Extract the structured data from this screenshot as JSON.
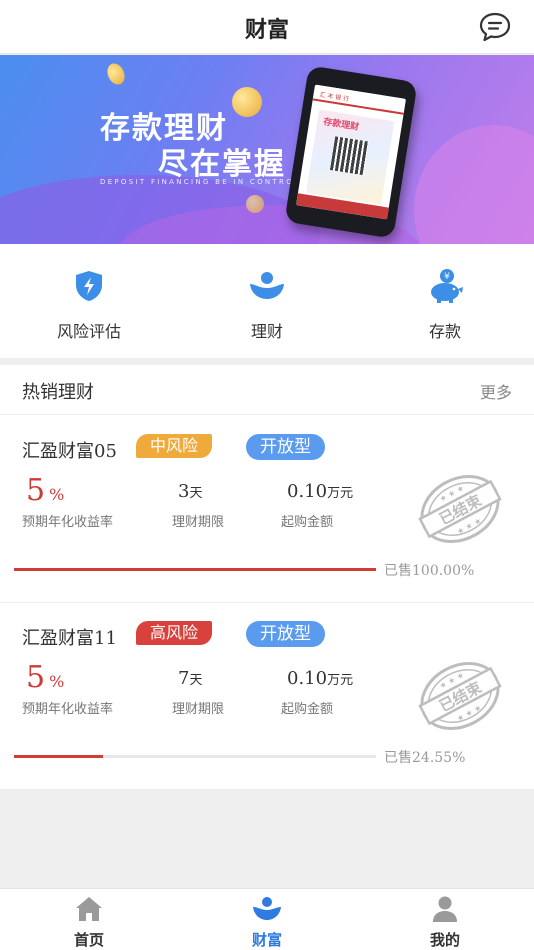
{
  "header": {
    "title": "财富",
    "message_icon": "chat-bubble-icon"
  },
  "banner": {
    "headline_1": "存款理财",
    "headline_2": "尽在掌握",
    "subtitle": "DEPOSIT FINANCING BE IN CONTROL",
    "phone_screen_title": "汇 丰 银 行",
    "phone_screen_text": "存款理财"
  },
  "quick_menu": [
    {
      "label": "风险评估",
      "icon": "shield-bolt-icon"
    },
    {
      "label": "理财",
      "icon": "wealth-icon"
    },
    {
      "label": "存款",
      "icon": "piggy-bank-icon"
    }
  ],
  "hot_products": {
    "title": "热销理财",
    "more": "更多",
    "captions": {
      "rate": "预期年化收益率",
      "term": "理财期限",
      "min_amount": "起购金额"
    },
    "items": [
      {
        "name": "汇盈财富05",
        "risk": "中风险",
        "risk_color": "#f0a93b",
        "type": "开放型",
        "rate": "5",
        "rate_unit": "%",
        "term": "3",
        "term_unit": "天",
        "min_amount": "0.10",
        "min_amount_unit": "万元",
        "stamp": "已结束",
        "sold_label": "已售100.00%",
        "sold_fraction": 1.0
      },
      {
        "name": "汇盈财富11",
        "risk": "高风险",
        "risk_color": "#d9423c",
        "type": "开放型",
        "rate": "5",
        "rate_unit": "%",
        "term": "7",
        "term_unit": "天",
        "min_amount": "0.10",
        "min_amount_unit": "万元",
        "stamp": "已结束",
        "sold_label": "已售24.55%",
        "sold_fraction": 0.2455
      }
    ]
  },
  "tabbar": {
    "items": [
      {
        "label": "首页",
        "icon": "home-icon"
      },
      {
        "label": "财富",
        "icon": "wealth-icon"
      },
      {
        "label": "我的",
        "icon": "user-icon"
      }
    ],
    "active_color": "#2f7bdf"
  }
}
